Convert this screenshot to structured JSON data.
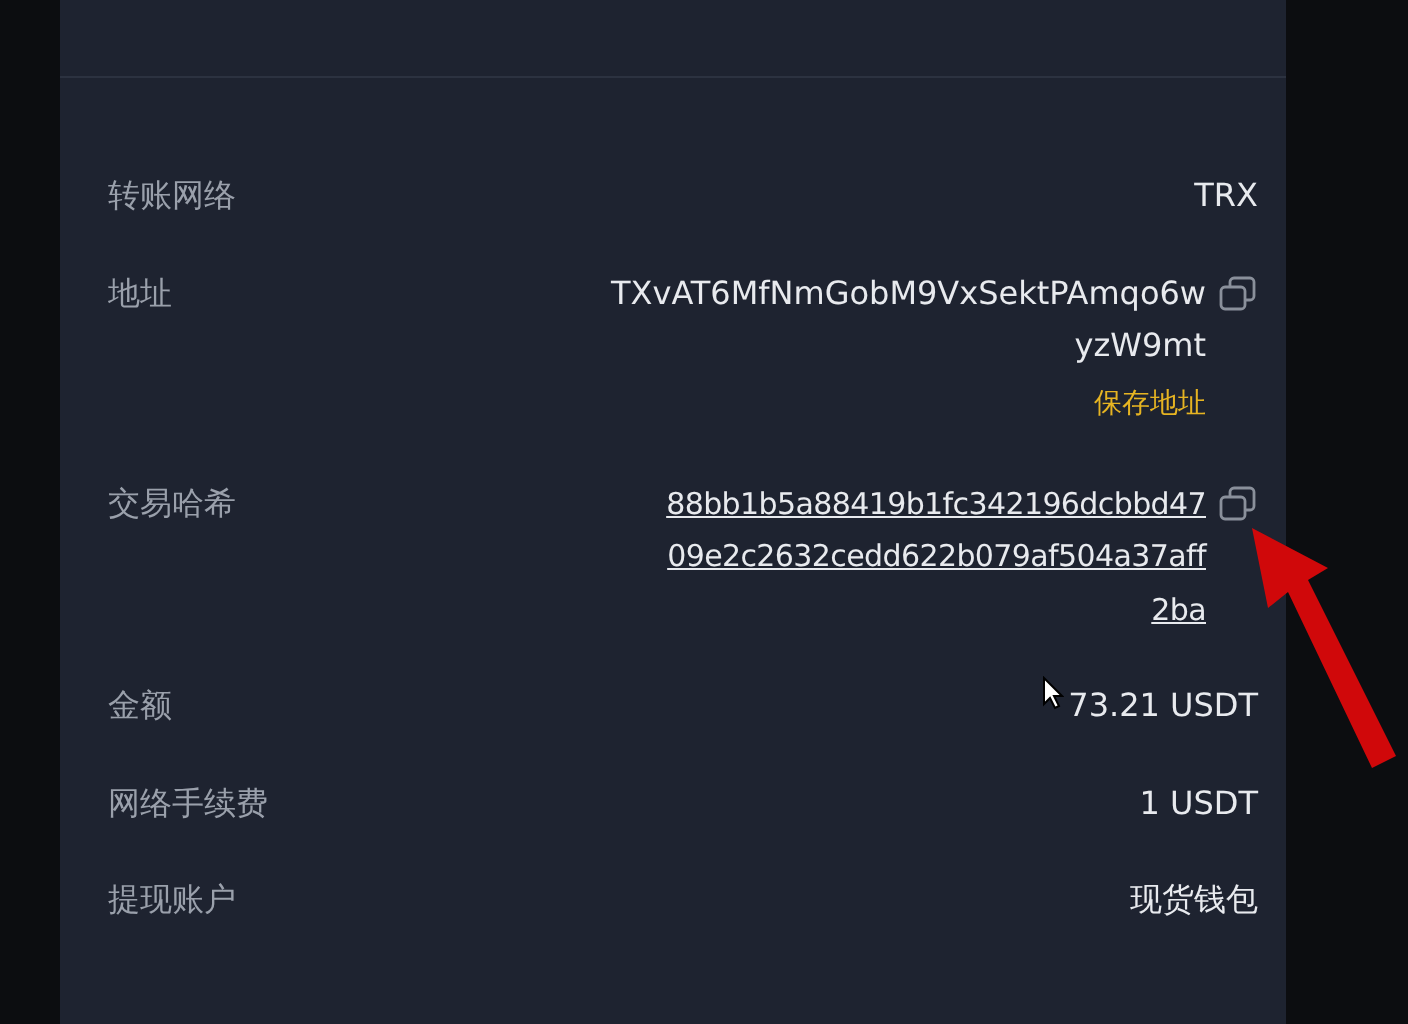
{
  "rows": [
    {
      "kind": "text",
      "label": "转账网络",
      "value": [
        "TRX"
      ]
    },
    {
      "kind": "address",
      "label": "地址",
      "value": [
        "TXvAT6MfNmGobM9VxSektPAmqo6w",
        "yzW9mt"
      ],
      "action": "保存地址"
    },
    {
      "kind": "hash",
      "label": "交易哈希",
      "value": [
        "88bb1b5a88419b1fc342196dcbbd47",
        "09e2c2632cedd622b079af504a37aff",
        "2ba"
      ]
    },
    {
      "kind": "text",
      "label": "金额",
      "value": [
        "73.21 USDT"
      ]
    },
    {
      "kind": "text",
      "label": "网络手续费",
      "value": [
        "1 USDT"
      ]
    },
    {
      "kind": "text",
      "label": "提现账户",
      "value": [
        "现货钱包"
      ]
    }
  ]
}
